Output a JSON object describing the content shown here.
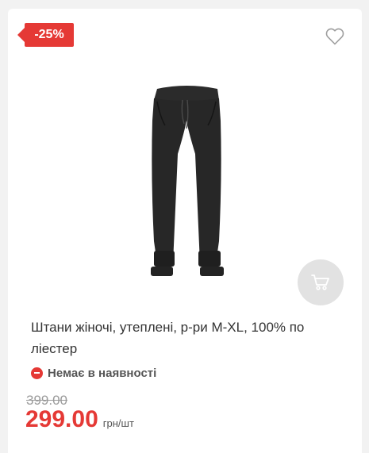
{
  "card": {
    "discount_badge": "-25%",
    "title": "Штани жіночі, утеплені, р-ри M-XL, 100% по ліестер",
    "availability": "Немає в наявності",
    "old_price": "399.00",
    "price": "299.00",
    "unit": "грн/шт"
  },
  "icons": {
    "favorite": "heart-outline-icon",
    "cart": "cart-icon",
    "availability": "minus-circle-icon"
  },
  "colors": {
    "accent": "#e53935",
    "cart_button_bg": "#e2e2e2",
    "text": "#333333",
    "muted": "#9a9a9a"
  }
}
